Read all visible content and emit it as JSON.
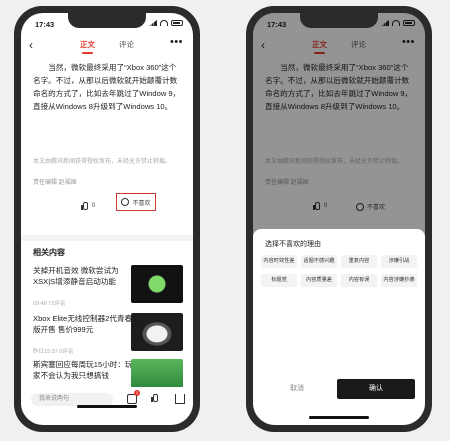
{
  "status": {
    "time": "17:43"
  },
  "nav": {
    "back": "‹",
    "tab_body": "正文",
    "tab_comments": "评论",
    "more": "•••"
  },
  "article": {
    "paragraph": "当然，微软最终采用了“Xbox 360”这个名字。不过，从那以后微软就开始颠覆计数命名的方式了，比如去年跳过了Window 9，直接从Windows 8升级到了Windows 10。",
    "copyright": "本文由腾讯新闻获得授权发布，未经允许禁止转载。",
    "editor": "责任编辑 赵福国"
  },
  "reactions": {
    "like_count": "0",
    "dislike_label": "不喜欢"
  },
  "related": {
    "title": "相关内容",
    "items": [
      {
        "title": "关掉开机音效 微软尝试为XSX|S增添静音启动功能",
        "meta": "09:48  72评论"
      },
      {
        "title": "Xbox Elite无线控制器2代青春版开售 售价999元",
        "meta": "昨日15:37  0评论"
      },
      {
        "title": "斯宾塞回应每周玩15小时：玩家不会认为我只想搞钱",
        "meta": ""
      }
    ]
  },
  "bottom": {
    "comment_placeholder": "我来说两句",
    "badge": "1"
  },
  "sheet": {
    "title": "选择不喜欢的理由",
    "reasons": [
      "内容时效性差",
      "话题不感兴趣",
      "重复内容",
      "涉嫌引战",
      "标题党",
      "内容质量差",
      "内容有误",
      "内容涉嫌抄袭"
    ],
    "cancel": "取消",
    "confirm": "确认"
  }
}
